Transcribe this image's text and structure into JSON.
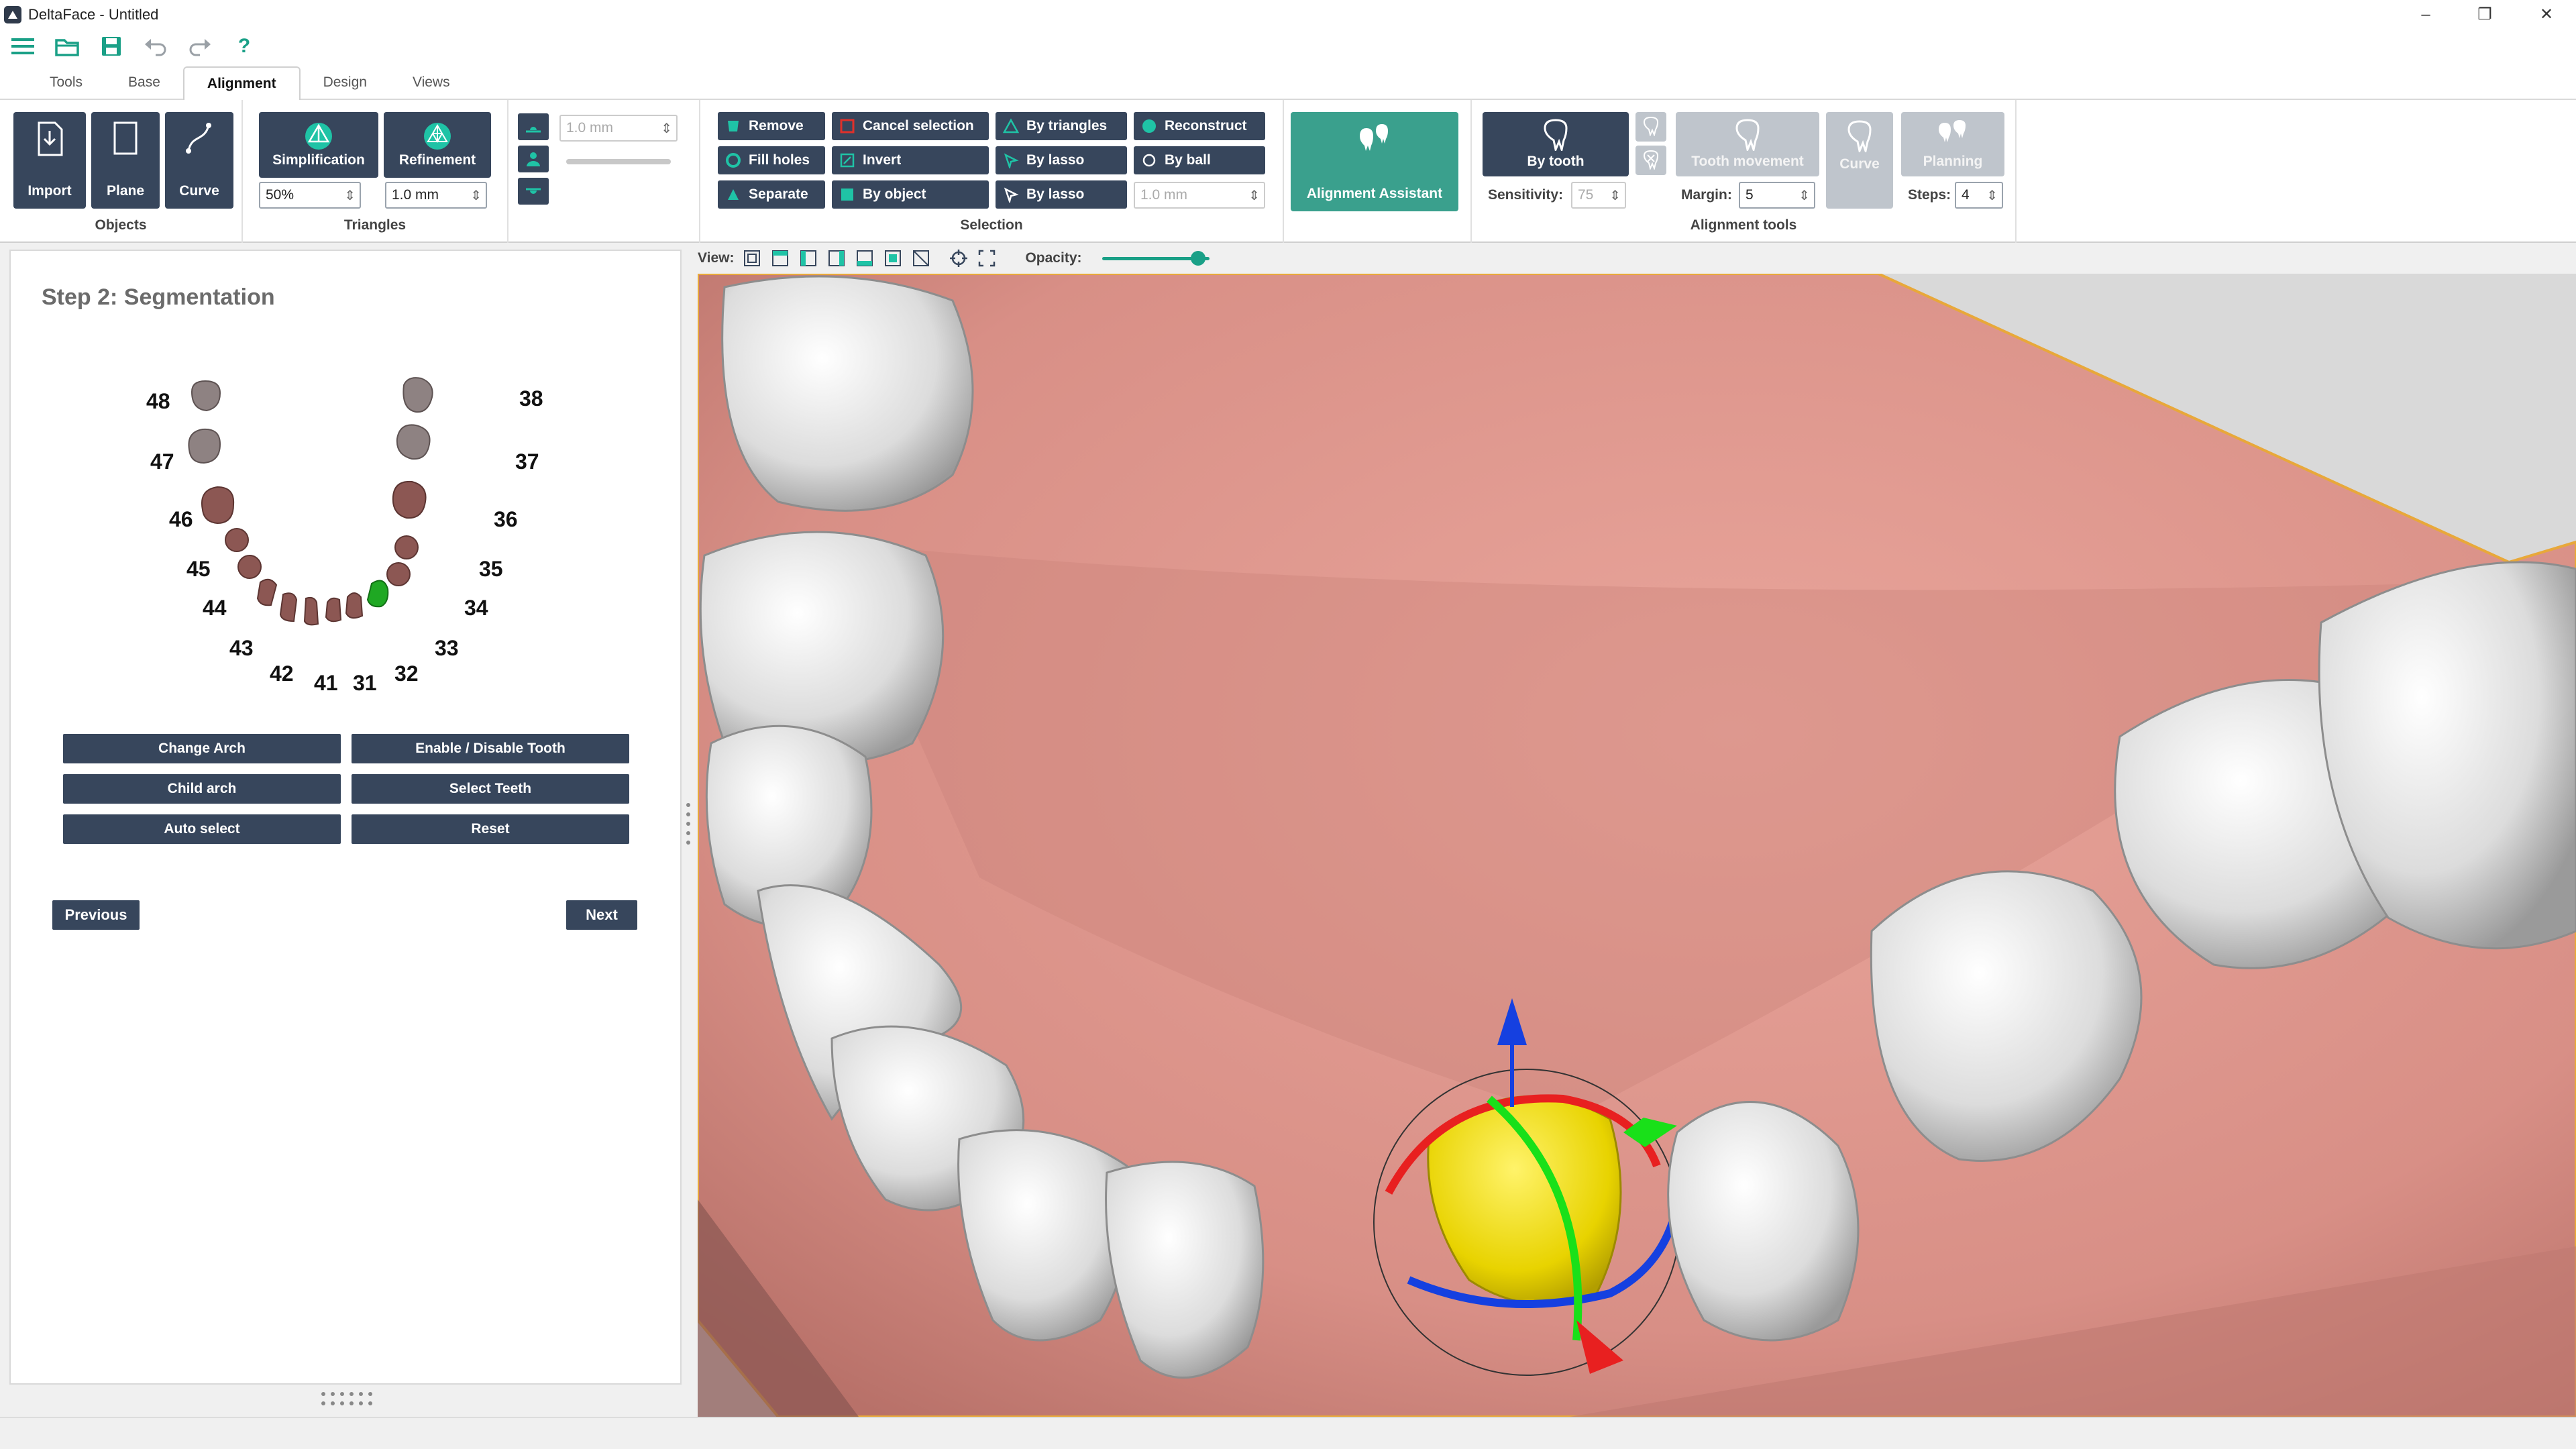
{
  "window": {
    "title": "DeltaFace - Untitled",
    "minimize": "–",
    "restore": "❐",
    "close": "✕"
  },
  "quickbar": {
    "help": "?"
  },
  "tabs": [
    "Tools",
    "Base",
    "Alignment",
    "Design",
    "Views"
  ],
  "active_tab": "Alignment",
  "ribbon": {
    "objects": {
      "label": "Objects",
      "import": "Import",
      "plane": "Plane",
      "curve": "Curve"
    },
    "triangles": {
      "label": "Triangles",
      "simplification": "Simplification",
      "refinement": "Refinement",
      "simplification_value": "50%",
      "refinement_value": "1.0 mm"
    },
    "plane_tools": {
      "value": "1.0 mm"
    },
    "selection": {
      "label": "Selection",
      "remove": "Remove",
      "cancel_selection": "Cancel selection",
      "by_triangles": "By triangles",
      "reconstruct": "Reconstruct",
      "fill_holes": "Fill holes",
      "invert": "Invert",
      "by_lasso_1": "By lasso",
      "by_ball": "By ball",
      "separate": "Separate",
      "by_object": "By object",
      "by_lasso_2": "By lasso",
      "ball_value": "1.0 mm"
    },
    "assistant": {
      "label": "Alignment Assistant"
    },
    "alignment_tools": {
      "label": "Alignment tools",
      "by_tooth": "By tooth",
      "tooth_movement": "Tooth movement",
      "curve": "Curve",
      "planning": "Planning",
      "sensitivity_label": "Sensitivity:",
      "sensitivity_value": "75",
      "margin_label": "Margin:",
      "margin_value": "5",
      "steps_label": "Steps:",
      "steps_value": "4"
    }
  },
  "panel": {
    "title": "Step 2: Segmentation",
    "teeth_numbers": [
      "48",
      "47",
      "46",
      "45",
      "44",
      "43",
      "42",
      "41",
      "31",
      "32",
      "33",
      "34",
      "35",
      "36",
      "37",
      "38"
    ],
    "selected_tooth": "33",
    "colors": {
      "selected": "#1fa823",
      "tooth": "#8c5753",
      "disabled_tooth": "#8e8282"
    },
    "buttons": {
      "change_arch": "Change Arch",
      "enable_disable": "Enable / Disable Tooth",
      "child_arch": "Child arch",
      "select_teeth": "Select Teeth",
      "auto_select": "Auto select",
      "reset": "Reset"
    },
    "previous": "Previous",
    "next": "Next"
  },
  "view_toolbar": {
    "view_label": "View:",
    "opacity_label": "Opacity:",
    "opacity": 0.85
  }
}
